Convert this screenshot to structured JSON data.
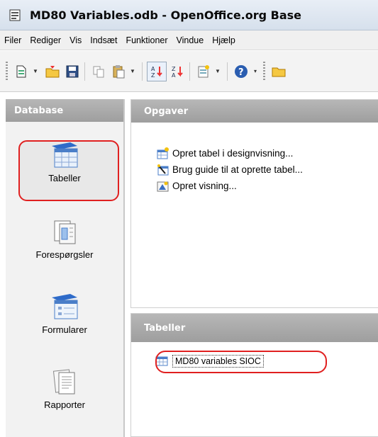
{
  "window": {
    "title": "MD80 Variables.odb - OpenOffice.org Base"
  },
  "menu": [
    "Filer",
    "Rediger",
    "Vis",
    "Indsæt",
    "Funktioner",
    "Vindue",
    "Hjælp"
  ],
  "sidebar": {
    "header": "Database",
    "items": [
      {
        "label": "Tabeller",
        "icon": "tables-icon",
        "selected": true
      },
      {
        "label": "Forespørgsler",
        "icon": "queries-icon"
      },
      {
        "label": "Formularer",
        "icon": "forms-icon"
      },
      {
        "label": "Rapporter",
        "icon": "reports-icon"
      }
    ]
  },
  "tasks": {
    "header": "Opgaver",
    "items": [
      {
        "label": "Opret tabel i designvisning...",
        "icon": "create-table-design-icon"
      },
      {
        "label": "Brug guide til at oprette tabel...",
        "icon": "table-wizard-icon"
      },
      {
        "label": "Opret visning...",
        "icon": "create-view-icon"
      }
    ]
  },
  "tables": {
    "header": "Tabeller",
    "items": [
      {
        "label": "MD80 variables SIOC",
        "icon": "table-icon"
      }
    ]
  },
  "colors": {
    "highlight_ring": "#e02020",
    "pane_header": "#a8a8a8"
  }
}
